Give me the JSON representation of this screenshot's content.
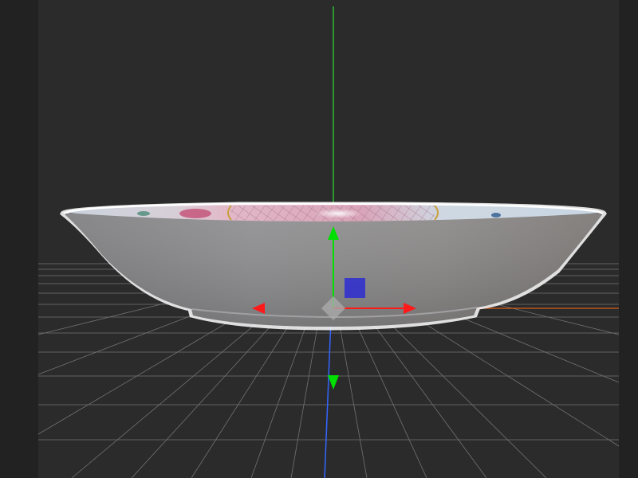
{
  "viewport": {
    "background": "#2b2b2b",
    "side_panel_color": "#222222",
    "grid_color": "#8a8a8a",
    "grid_visible": true
  },
  "axes": {
    "y_axis_color": "#33ff33",
    "z_axis_color": "#3366ff",
    "x_axis_color": "#ff6a1a"
  },
  "gizmo": {
    "mode": "translate",
    "x_arrow_color": "#ff1a1a",
    "y_arrow_color": "#00e000",
    "plane_handle_color": "#3333cc",
    "center_handle_color": "#aaaaaa"
  },
  "model": {
    "object": "porcelain dish",
    "selected": true,
    "selection_outline_color": "#ffffff",
    "glaze_color": "#8f8f8f",
    "rim_pattern_color": "#d9a3b8"
  }
}
